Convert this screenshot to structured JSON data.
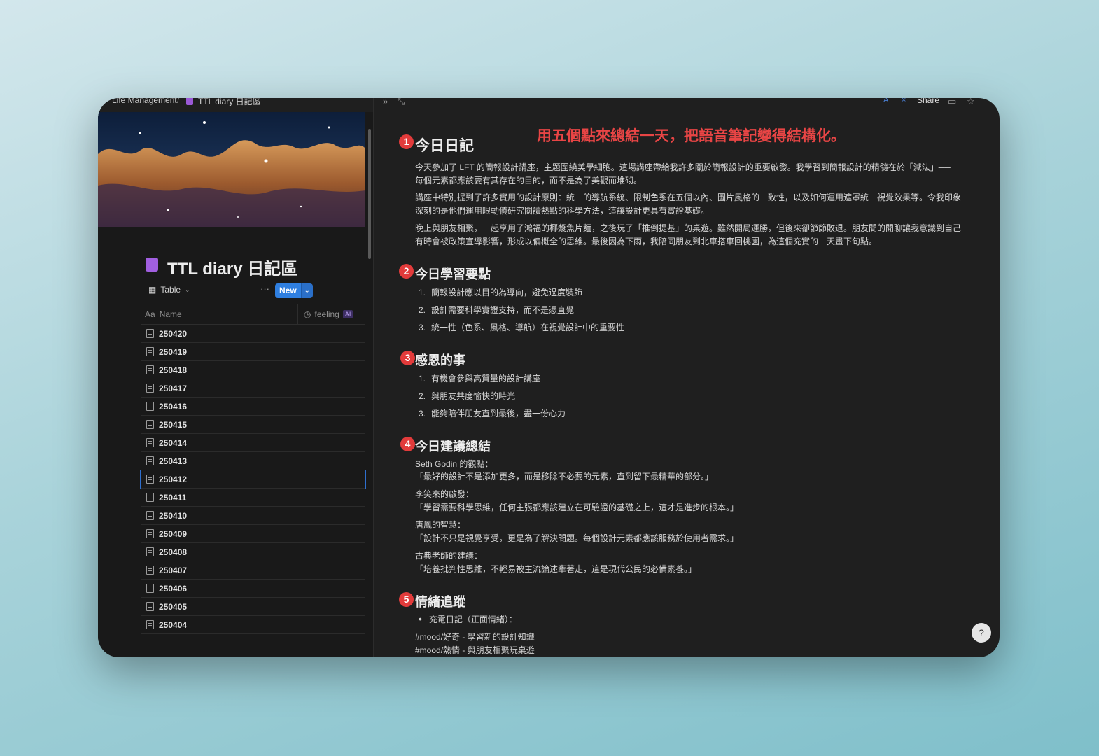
{
  "topbar": {
    "breadcrumb_1": "Life Management",
    "breadcrumb_sep": "/",
    "breadcrumb_2": "TTL diary 日記區",
    "share": "Share"
  },
  "database": {
    "title": "TTL diary 日記區",
    "view_label": "Table",
    "more": "···",
    "new_button": "New",
    "col_name_prefix": "Aa",
    "col_name": "Name",
    "col_feeling": "feeling",
    "ai_tag": "AI",
    "rows": [
      "250420",
      "250419",
      "250418",
      "250417",
      "250416",
      "250415",
      "250414",
      "250413",
      "250412",
      "250411",
      "250410",
      "250409",
      "250408",
      "250407",
      "250406",
      "250405",
      "250404"
    ],
    "selected_row": "250412"
  },
  "page": {
    "promo": "用五個點來總結一天，把語音筆記變得結構化。",
    "s1": {
      "num": "1",
      "title": "今日日記",
      "p1": "今天參加了 LFT 的簡報設計講座，主題圍繞美學細胞。這場講座帶給我許多關於簡報設計的重要啟發。我學習到簡報設計的精髓在於「減法」── 每個元素都應該要有其存在的目的，而不是為了美觀而堆砌。",
      "p2": "講座中特別提到了許多實用的設計原則：統一的導航系統、限制色系在五個以內、圖片風格的一致性，以及如何運用遮罩統一視覺效果等。令我印象深刻的是他們運用眼動儀研究閱讀熱點的科學方法，這讓設計更具有實證基礎。",
      "p3": "晚上與朋友相聚，一起享用了鴻福的椰漿魚片麵，之後玩了「推倒提基」的桌遊。雖然開局運勝，但後來卻節節敗退。朋友間的閒聊讓我意識到自己有時會被政策宣導影響，形成以偏概全的思維。最後因為下雨，我陪同朋友到北車搭車回桃園，為這個充實的一天畫下句點。"
    },
    "s2": {
      "num": "2",
      "title": "今日學習要點",
      "items": [
        "簡報設計應以目的為導向，避免過度裝飾",
        "設計需要科學實證支持，而不是憑直覺",
        "統一性（色系、風格、導航）在視覺設計中的重要性"
      ]
    },
    "s3": {
      "num": "3",
      "title": "感恩的事",
      "items": [
        "有機會參與高質量的設計講座",
        "與朋友共度愉快的時光",
        "能夠陪伴朋友直到最後，盡一份心力"
      ]
    },
    "s4": {
      "num": "4",
      "title": "今日建議總結",
      "q1_head": "Seth Godin 的觀點：",
      "q1": "「最好的設計不是添加更多，而是移除不必要的元素，直到留下最精華的部分。」",
      "q2_head": "李笑來的啟發：",
      "q2": "「學習需要科學思維，任何主張都應該建立在可驗證的基礎之上，這才是進步的根本。」",
      "q3_head": "唐鳳的智慧：",
      "q3": "「設計不只是視覺享受，更是為了解決問題。每個設計元素都應該服務於使用者需求。」",
      "q4_head": "古典老師的建議：",
      "q4": "「培養批判性思維，不輕易被主流論述牽著走，這是現代公民的必備素養。」"
    },
    "s5": {
      "num": "5",
      "title": "情緒追蹤",
      "bullet": "充電日記（正面情緒）：",
      "mood1": "#mood/好奇 - 學習新的設計知識",
      "mood2": "#mood/熱情 - 與朋友相聚玩桌遊"
    }
  },
  "help": "?"
}
